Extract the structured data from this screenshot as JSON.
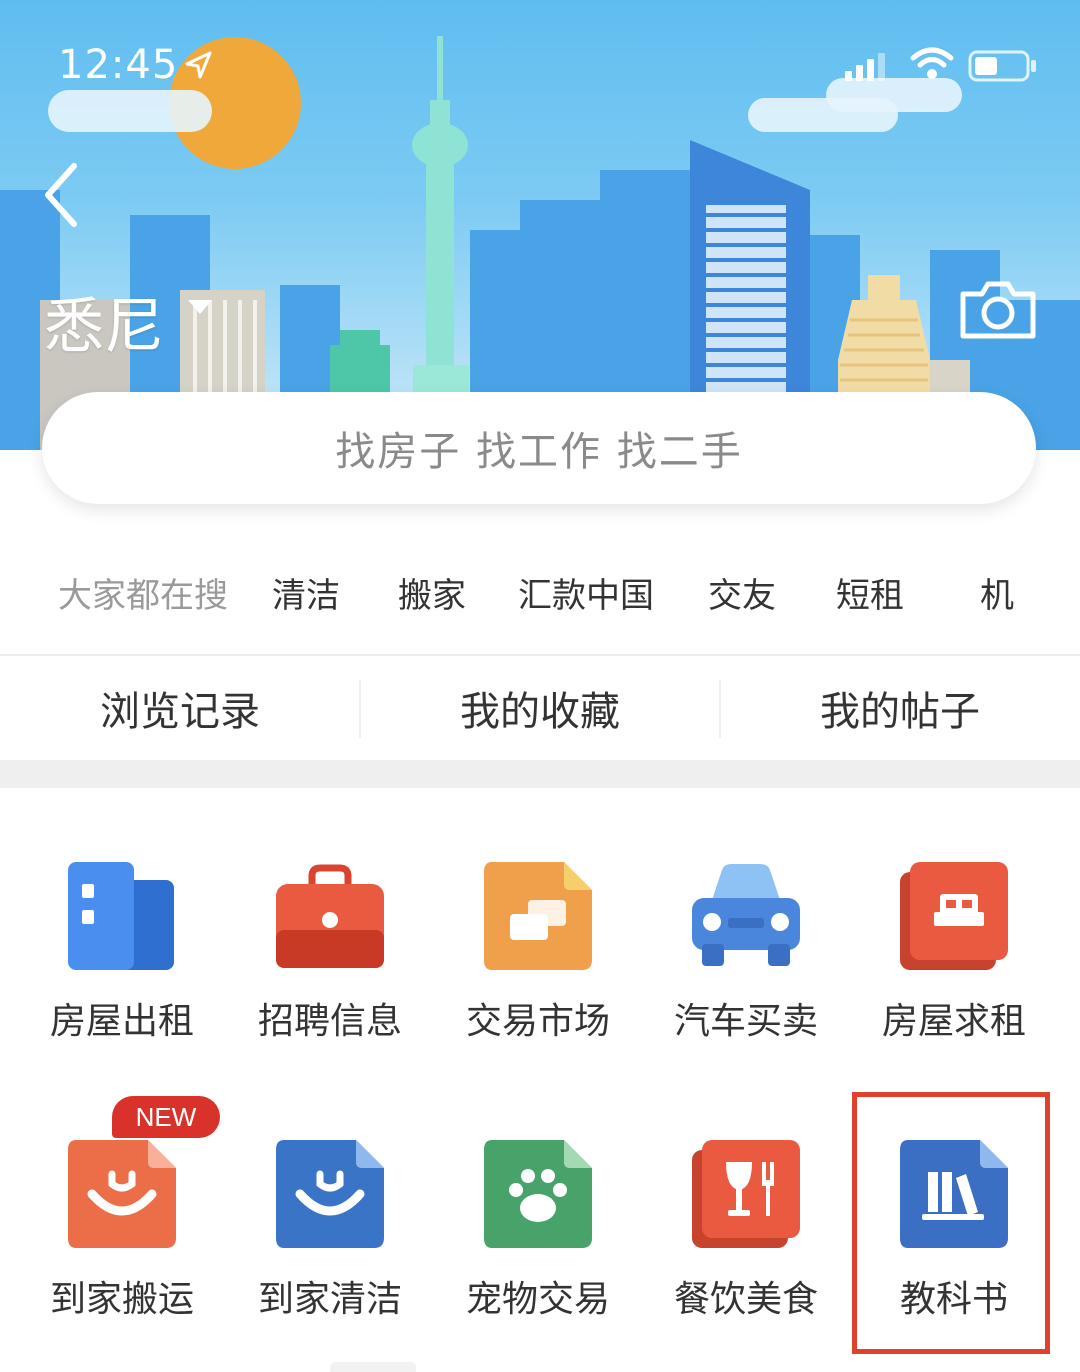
{
  "status_bar": {
    "time": "12:45"
  },
  "header": {
    "city": "悉尼"
  },
  "search": {
    "placeholder": "找房子 找工作 找二手"
  },
  "hot_search": {
    "label": "大家都在搜",
    "items": [
      "清洁",
      "搬家",
      "汇款中国",
      "交友",
      "短租",
      "机"
    ]
  },
  "quick_links": [
    "浏览记录",
    "我的收藏",
    "我的帖子"
  ],
  "categories": [
    {
      "label": "房屋出租",
      "icon": "building-icon",
      "color": "#3f7fe0"
    },
    {
      "label": "招聘信息",
      "icon": "briefcase-icon",
      "color": "#e0553c"
    },
    {
      "label": "交易市场",
      "icon": "exchange-icon",
      "color": "#f0a04b"
    },
    {
      "label": "汽车买卖",
      "icon": "car-icon",
      "color": "#4a86dc"
    },
    {
      "label": "房屋求租",
      "icon": "bed-icon",
      "color": "#e0553c"
    },
    {
      "label": "到家搬运",
      "icon": "smile-doc-icon",
      "color": "#ec6e48",
      "badge": "NEW"
    },
    {
      "label": "到家清洁",
      "icon": "smile-doc-icon",
      "color": "#3a74c6"
    },
    {
      "label": "宠物交易",
      "icon": "paw-icon",
      "color": "#48a36a"
    },
    {
      "label": "餐饮美食",
      "icon": "cutlery-icon",
      "color": "#e0553c"
    },
    {
      "label": "教科书",
      "icon": "books-icon",
      "color": "#3a6fc3"
    }
  ],
  "colors": {
    "highlight": "#e0402c",
    "badge": "#d8322a"
  }
}
